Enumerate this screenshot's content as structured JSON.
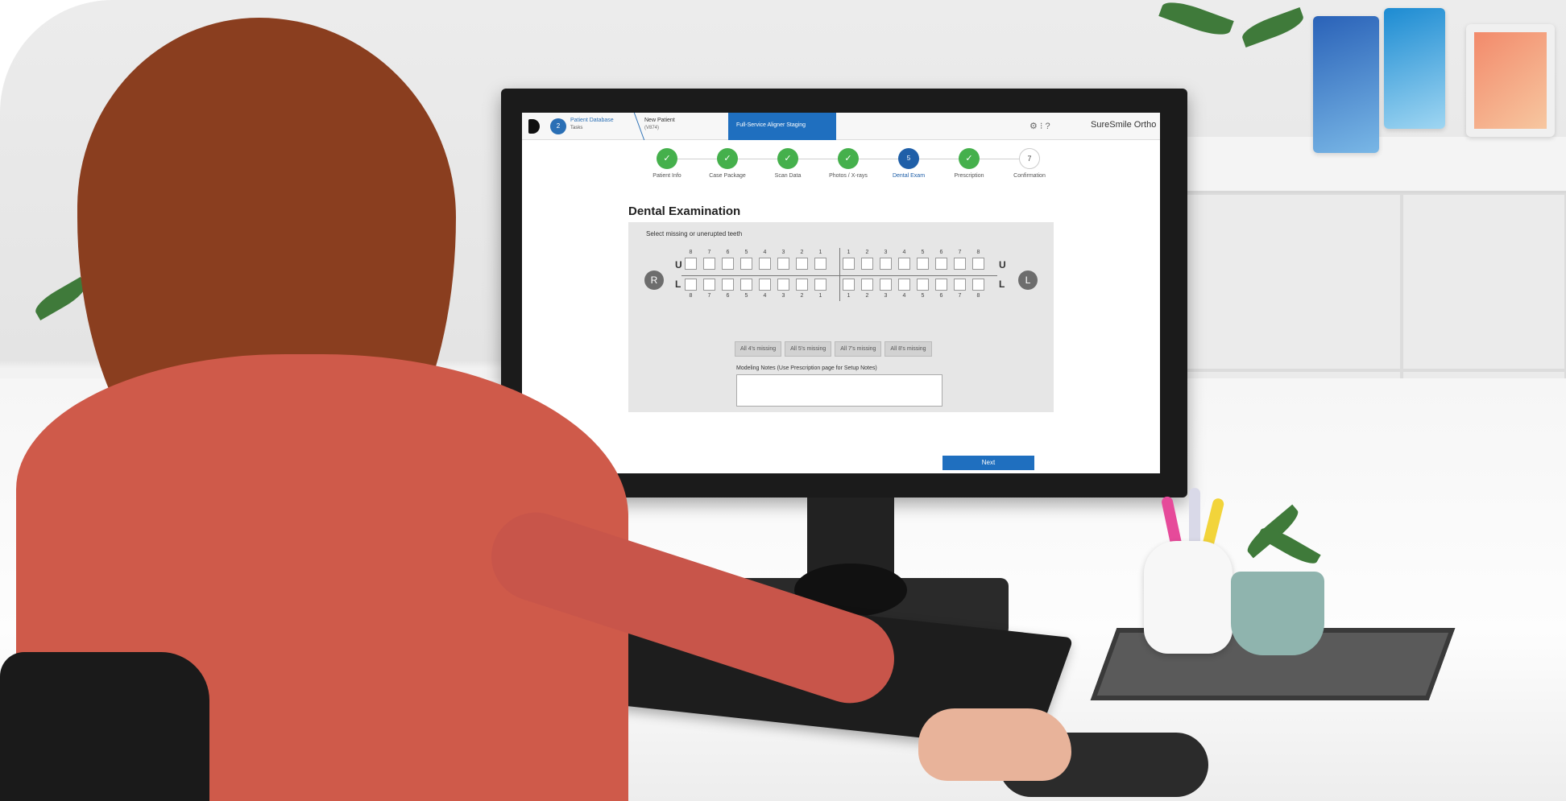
{
  "app": {
    "header": {
      "crumb_badge": "2",
      "crumb1_title": "Patient Database",
      "crumb1_sub": "Tasks",
      "crumb2_title": "New Patient",
      "crumb2_sub": "(V874)",
      "active_tab": "Full-Service Aligner Staging",
      "icons": "⚙ ⁝  ?",
      "brand": "SureSmile Ortho"
    },
    "steps": [
      {
        "label": "Patient Info",
        "state": "done",
        "mark": "✓"
      },
      {
        "label": "Case Package",
        "state": "done",
        "mark": "✓"
      },
      {
        "label": "Scan Data",
        "state": "done",
        "mark": "✓"
      },
      {
        "label": "Photos / X-rays",
        "state": "done",
        "mark": "✓"
      },
      {
        "label": "Dental Exam",
        "state": "current",
        "mark": "5"
      },
      {
        "label": "Prescription",
        "state": "done",
        "mark": "✓"
      },
      {
        "label": "Confirmation",
        "state": "todo",
        "mark": "7"
      }
    ],
    "page_title": "Dental Examination",
    "instruction": "Select missing or unerupted teeth",
    "jaw": {
      "upper": "U",
      "lower": "L",
      "right_side": "R",
      "left_side": "L",
      "right_numbers": [
        "8",
        "7",
        "6",
        "5",
        "4",
        "3",
        "2",
        "1"
      ],
      "left_numbers": [
        "1",
        "2",
        "3",
        "4",
        "5",
        "6",
        "7",
        "8"
      ]
    },
    "quick_buttons": [
      "All 4's missing",
      "All 5's missing",
      "All 7's missing",
      "All 8's missing"
    ],
    "notes_label": "Modeling Notes (Use Prescription page for Setup Notes)",
    "next_label": "Next"
  },
  "colors": {
    "primary": "#1f6fbf",
    "done": "#45b04c",
    "current": "#1f5fa8"
  }
}
